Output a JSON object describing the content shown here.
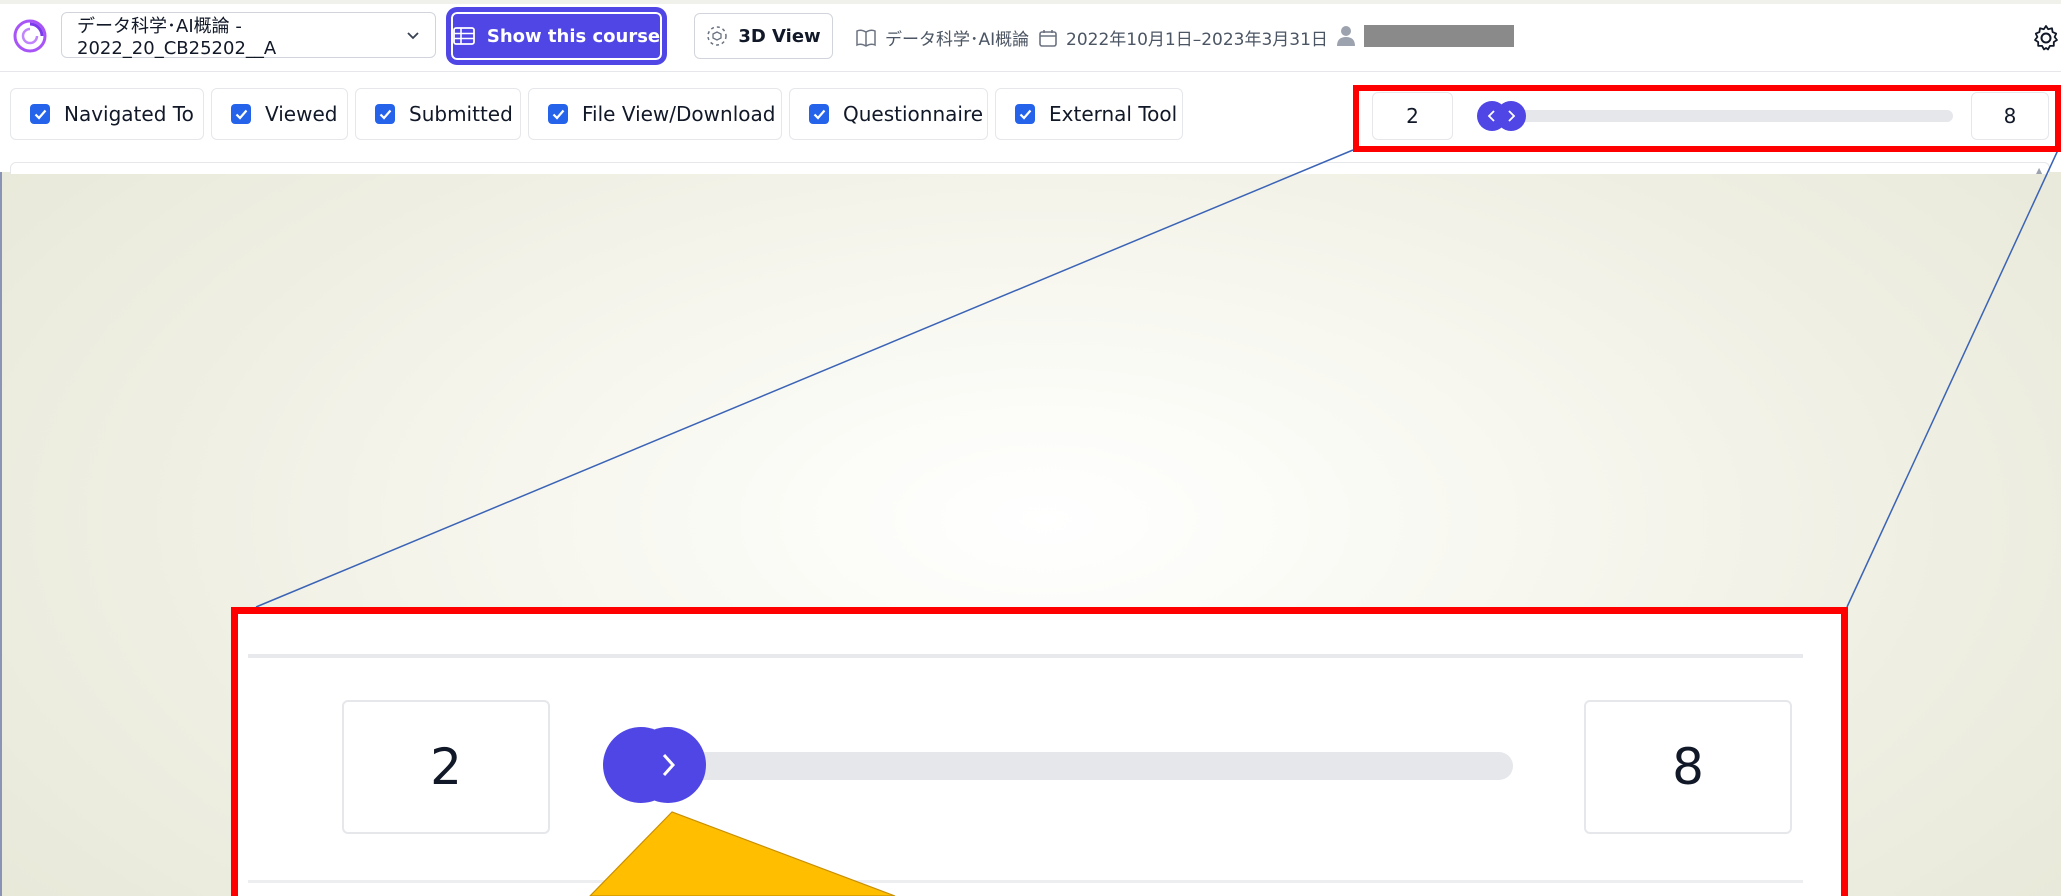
{
  "header": {
    "course_select_value": "データ科学･AI概論 - 2022_20_CB25202__A",
    "show_course_label": "Show this course",
    "view3d_label": "3D View",
    "course_name": "データ科学･AI概論",
    "date_range": "2022年10月1日–2023年3月31日",
    "icons": [
      "logo-icon",
      "chevron-down-icon",
      "table-icon",
      "cube-icon",
      "book-icon",
      "calendar-icon",
      "user-icon",
      "gear-icon"
    ]
  },
  "filters": [
    {
      "label": "Navigated To",
      "checked": true
    },
    {
      "label": "Viewed",
      "checked": true
    },
    {
      "label": "Submitted",
      "checked": true
    },
    {
      "label": "File View/Download",
      "checked": true
    },
    {
      "label": "Questionnaire",
      "checked": true
    },
    {
      "label": "External Tool",
      "checked": true
    }
  ],
  "range_slider": {
    "min_value": "2",
    "max_value": "8"
  },
  "zoom": {
    "min_value": "2",
    "max_value": "8"
  },
  "colors": {
    "accent": "#4f46e5",
    "checkbox": "#2563eb",
    "highlight": "#ff0000",
    "pointer": "#ffbf00",
    "connector": "#3b63b5"
  }
}
